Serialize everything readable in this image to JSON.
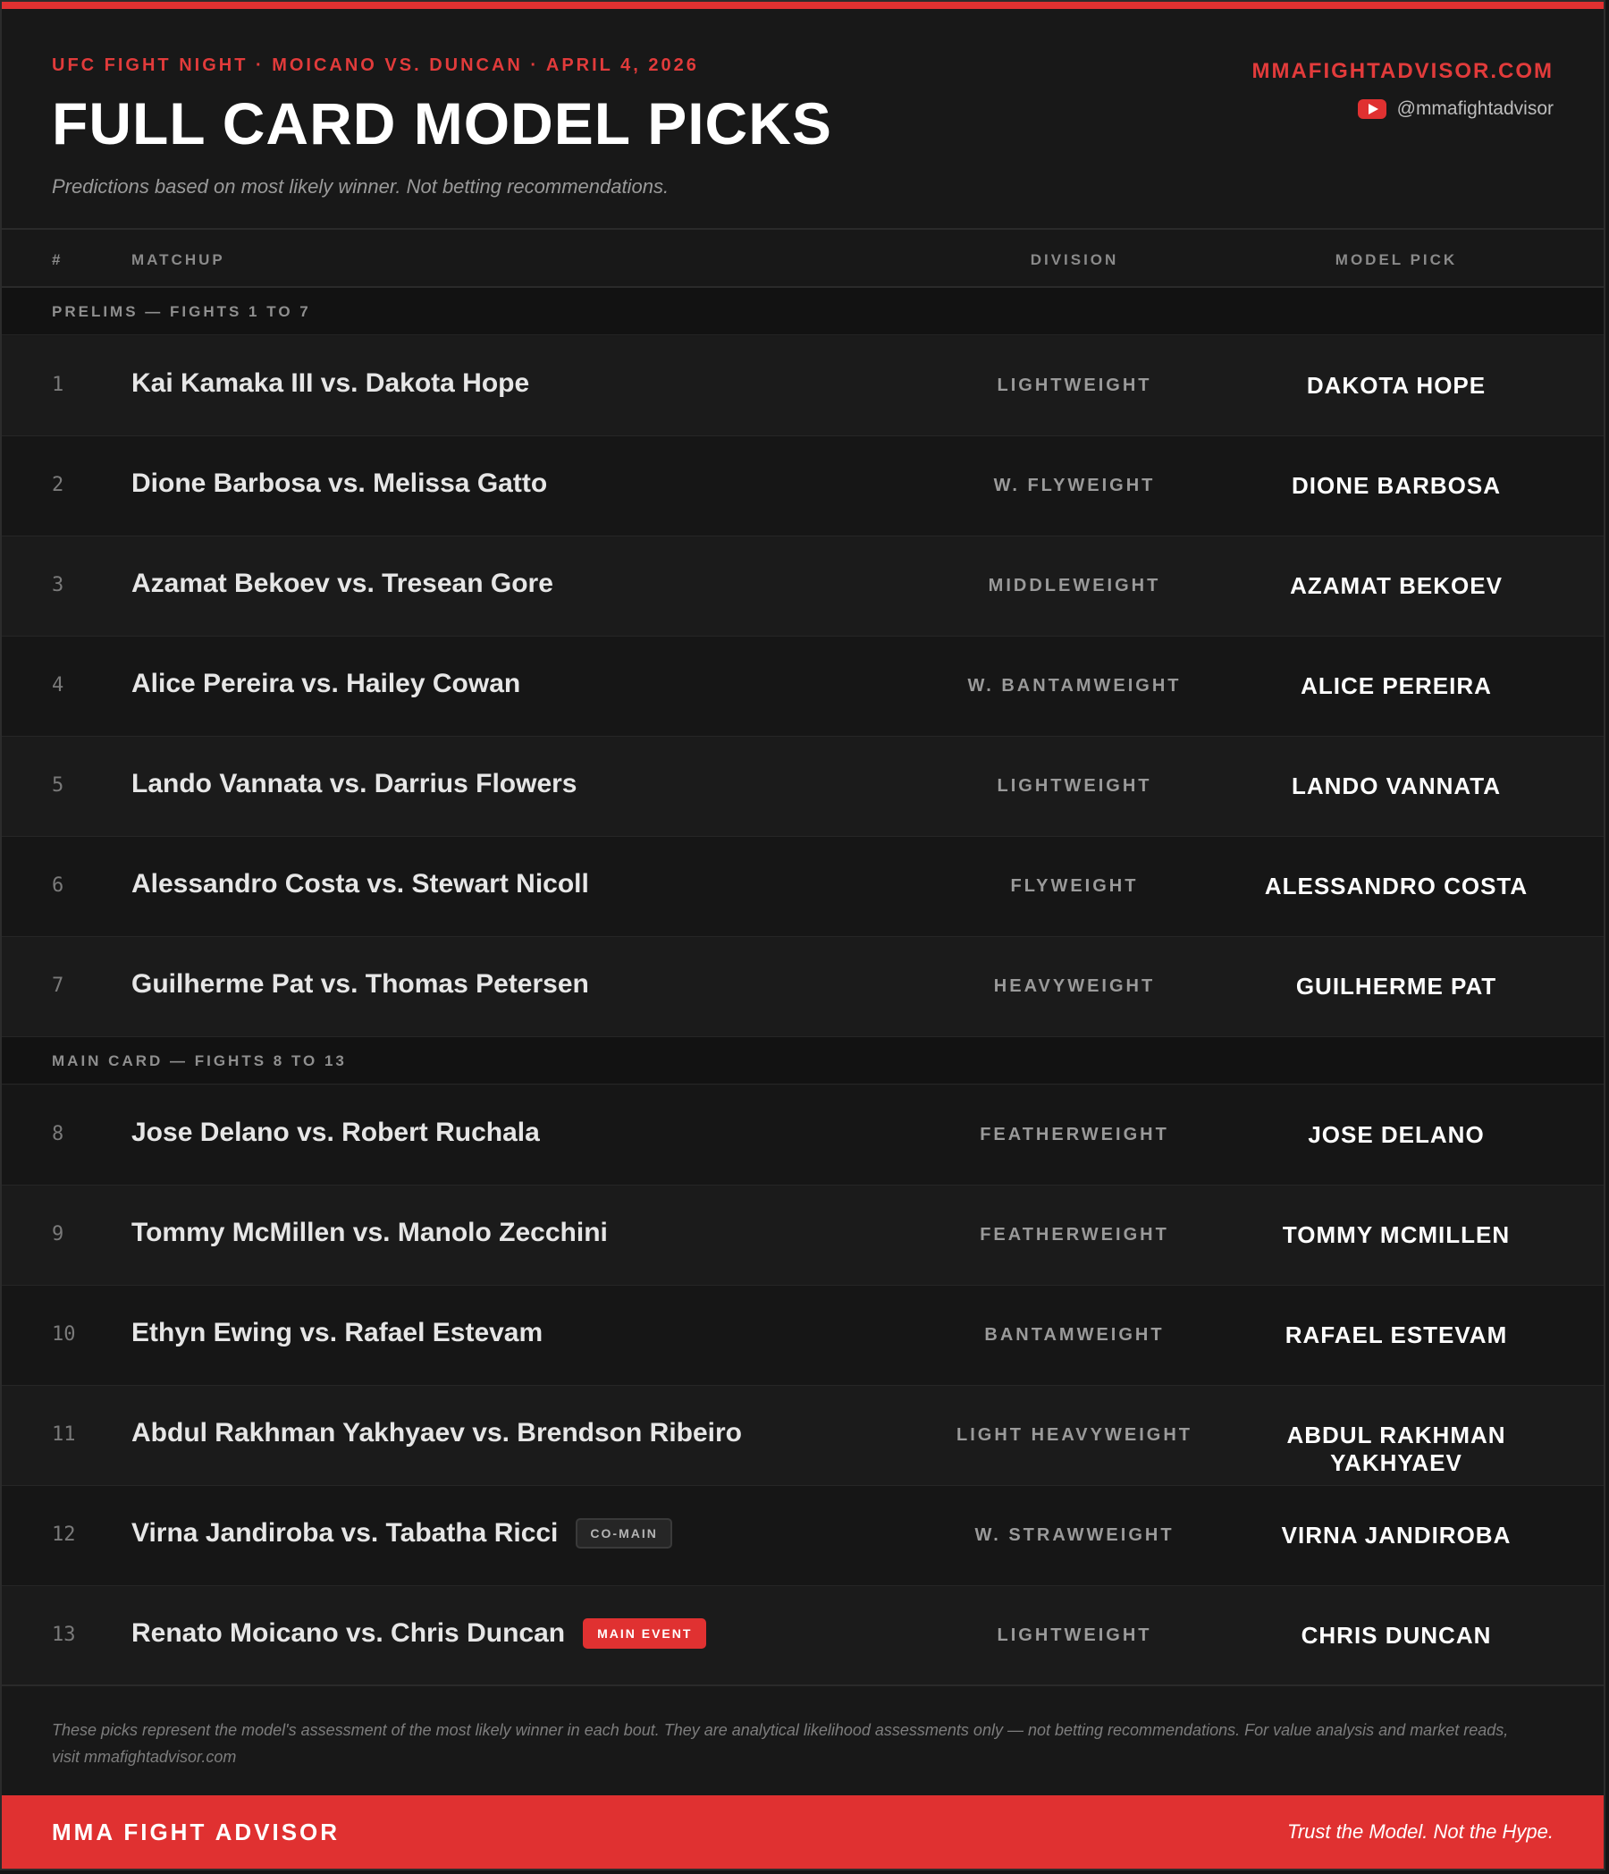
{
  "header": {
    "eyebrow": "UFC FIGHT NIGHT · MOICANO VS. DUNCAN · APRIL 4, 2026",
    "title": "FULL CARD MODEL PICKS",
    "subtitle": "Predictions based on most likely winner. Not betting recommendations.",
    "site": "MMAFIGHTADVISOR.COM",
    "youtube_handle": "@mmafightadvisor"
  },
  "columns": {
    "num": "#",
    "matchup": "MATCHUP",
    "division": "DIVISION",
    "pick": "MODEL PICK"
  },
  "sections": {
    "prelims": "PRELIMS — FIGHTS 1 TO 7",
    "main": "MAIN CARD — FIGHTS 8 TO 13"
  },
  "fights": [
    {
      "num": "1",
      "matchup": "Kai Kamaka III vs. Dakota Hope",
      "division": "LIGHTWEIGHT",
      "pick": "DAKOTA HOPE"
    },
    {
      "num": "2",
      "matchup": "Dione Barbosa vs. Melissa Gatto",
      "division": "W. FLYWEIGHT",
      "pick": "DIONE BARBOSA"
    },
    {
      "num": "3",
      "matchup": "Azamat Bekoev vs. Tresean Gore",
      "division": "MIDDLEWEIGHT",
      "pick": "AZAMAT BEKOEV"
    },
    {
      "num": "4",
      "matchup": "Alice Pereira vs. Hailey Cowan",
      "division": "W. BANTAMWEIGHT",
      "pick": "ALICE PEREIRA"
    },
    {
      "num": "5",
      "matchup": "Lando Vannata vs. Darrius Flowers",
      "division": "LIGHTWEIGHT",
      "pick": "LANDO VANNATA"
    },
    {
      "num": "6",
      "matchup": "Alessandro Costa vs. Stewart Nicoll",
      "division": "FLYWEIGHT",
      "pick": "ALESSANDRO COSTA"
    },
    {
      "num": "7",
      "matchup": "Guilherme Pat vs. Thomas Petersen",
      "division": "HEAVYWEIGHT",
      "pick": "GUILHERME PAT"
    },
    {
      "num": "8",
      "matchup": "Jose Delano vs. Robert Ruchala",
      "division": "FEATHERWEIGHT",
      "pick": "JOSE DELANO"
    },
    {
      "num": "9",
      "matchup": "Tommy McMillen vs. Manolo Zecchini",
      "division": "FEATHERWEIGHT",
      "pick": "TOMMY MCMILLEN"
    },
    {
      "num": "10",
      "matchup": "Ethyn Ewing vs. Rafael Estevam",
      "division": "BANTAMWEIGHT",
      "pick": "RAFAEL ESTEVAM"
    },
    {
      "num": "11",
      "matchup": "Abdul Rakhman Yakhyaev vs. Brendson Ribeiro",
      "division": "LIGHT HEAVYWEIGHT",
      "pick": "ABDUL RAKHMAN YAKHYAEV"
    },
    {
      "num": "12",
      "matchup": "Virna Jandiroba vs. Tabatha Ricci",
      "division": "W. STRAWWEIGHT",
      "pick": "VIRNA JANDIROBA",
      "badge": "CO-MAIN"
    },
    {
      "num": "13",
      "matchup": "Renato Moicano vs. Chris Duncan",
      "division": "LIGHTWEIGHT",
      "pick": "CHRIS DUNCAN",
      "badge": "MAIN EVENT"
    }
  ],
  "disclaimer": "These picks represent the model's assessment of the most likely winner in each bout. They are analytical likelihood assessments only — not betting recommendations. For value analysis and market reads, visit mmafightadvisor.com",
  "footer": {
    "brand": "MMA FIGHT ADVISOR",
    "tagline": "Trust the Model. Not the Hype."
  },
  "colors": {
    "accent": "#e03131",
    "background": "#181818",
    "text": "#ffffff"
  },
  "icons": {
    "youtube": "youtube-icon"
  }
}
